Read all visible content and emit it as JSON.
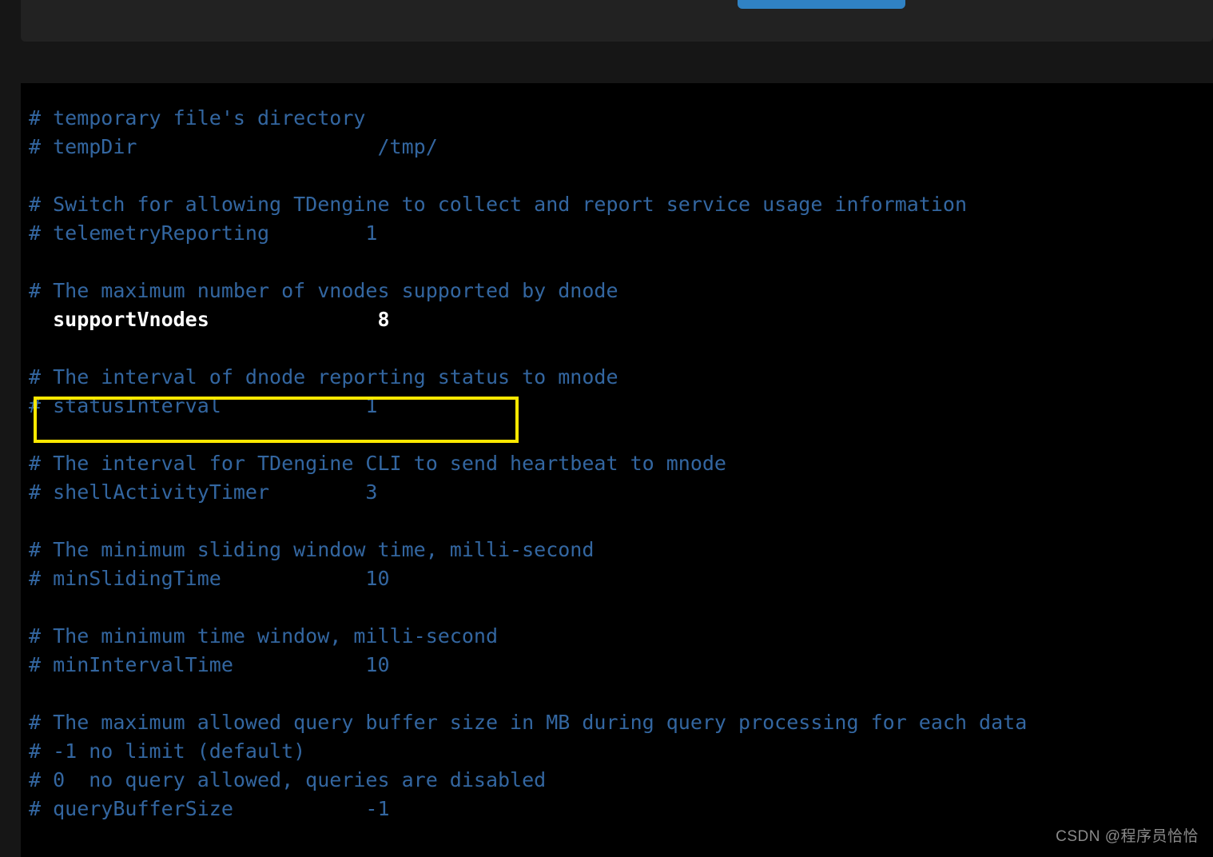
{
  "page": {
    "background_color": "#161616",
    "panel_color": "#222222",
    "code_background_color": "#000000"
  },
  "top_panel": {
    "button": {
      "label": "",
      "color": "#3082c4"
    }
  },
  "code": {
    "comment_color": "#3366a0",
    "active_color": "#ffffff",
    "lines": [
      {
        "text": "# temporary file's directory",
        "kind": "comment"
      },
      {
        "text": "# tempDir                    /tmp/",
        "kind": "comment"
      },
      {
        "text": "",
        "kind": "blank"
      },
      {
        "text": "# Switch for allowing TDengine to collect and report service usage information",
        "kind": "comment"
      },
      {
        "text": "# telemetryReporting        1",
        "kind": "comment"
      },
      {
        "text": "",
        "kind": "blank"
      },
      {
        "text": "# The maximum number of vnodes supported by dnode",
        "kind": "comment"
      },
      {
        "text": "  supportVnodes              8",
        "kind": "active"
      },
      {
        "text": "",
        "kind": "blank"
      },
      {
        "text": "# The interval of dnode reporting status to mnode",
        "kind": "comment"
      },
      {
        "text": "# statusInterval            1",
        "kind": "comment"
      },
      {
        "text": "",
        "kind": "blank"
      },
      {
        "text": "# The interval for TDengine CLI to send heartbeat to mnode",
        "kind": "comment"
      },
      {
        "text": "# shellActivityTimer        3",
        "kind": "comment"
      },
      {
        "text": "",
        "kind": "blank"
      },
      {
        "text": "# The minimum sliding window time, milli-second",
        "kind": "comment"
      },
      {
        "text": "# minSlidingTime            10",
        "kind": "comment"
      },
      {
        "text": "",
        "kind": "blank"
      },
      {
        "text": "# The minimum time window, milli-second",
        "kind": "comment"
      },
      {
        "text": "# minIntervalTime           10",
        "kind": "comment"
      },
      {
        "text": "",
        "kind": "blank"
      },
      {
        "text": "# The maximum allowed query buffer size in MB during query processing for each data",
        "kind": "comment"
      },
      {
        "text": "# -1 no limit (default)",
        "kind": "comment"
      },
      {
        "text": "# 0  no query allowed, queries are disabled",
        "kind": "comment"
      },
      {
        "text": "# queryBufferSize           -1",
        "kind": "comment"
      }
    ]
  },
  "annotation": {
    "target_line": "  supportVnodes              8",
    "border_color": "#ffe800"
  },
  "watermark": {
    "text": "CSDN @程序员恰恰"
  }
}
